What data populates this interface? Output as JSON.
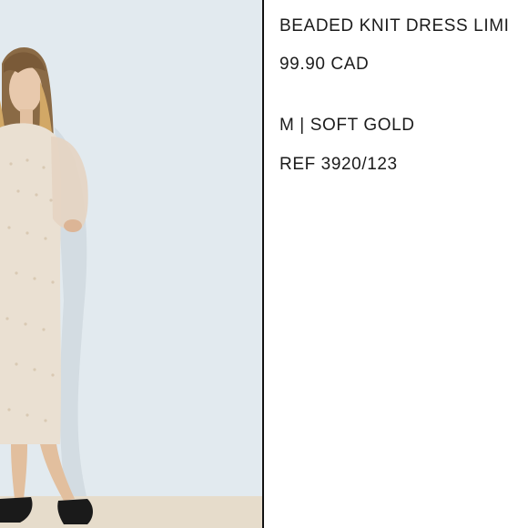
{
  "product": {
    "name": "BEADED KNIT DRESS LIMI",
    "price": "99.90 CAD",
    "variant": "M | SOFT GOLD",
    "reference": "REF 3920/123"
  },
  "colors": {
    "background": "#ffffff",
    "text": "#1b1b1b",
    "divider": "#111111",
    "photo_wall": "#e4ecf1",
    "dress": "#eae0d2",
    "hair": "#c69a5a"
  },
  "icons": []
}
